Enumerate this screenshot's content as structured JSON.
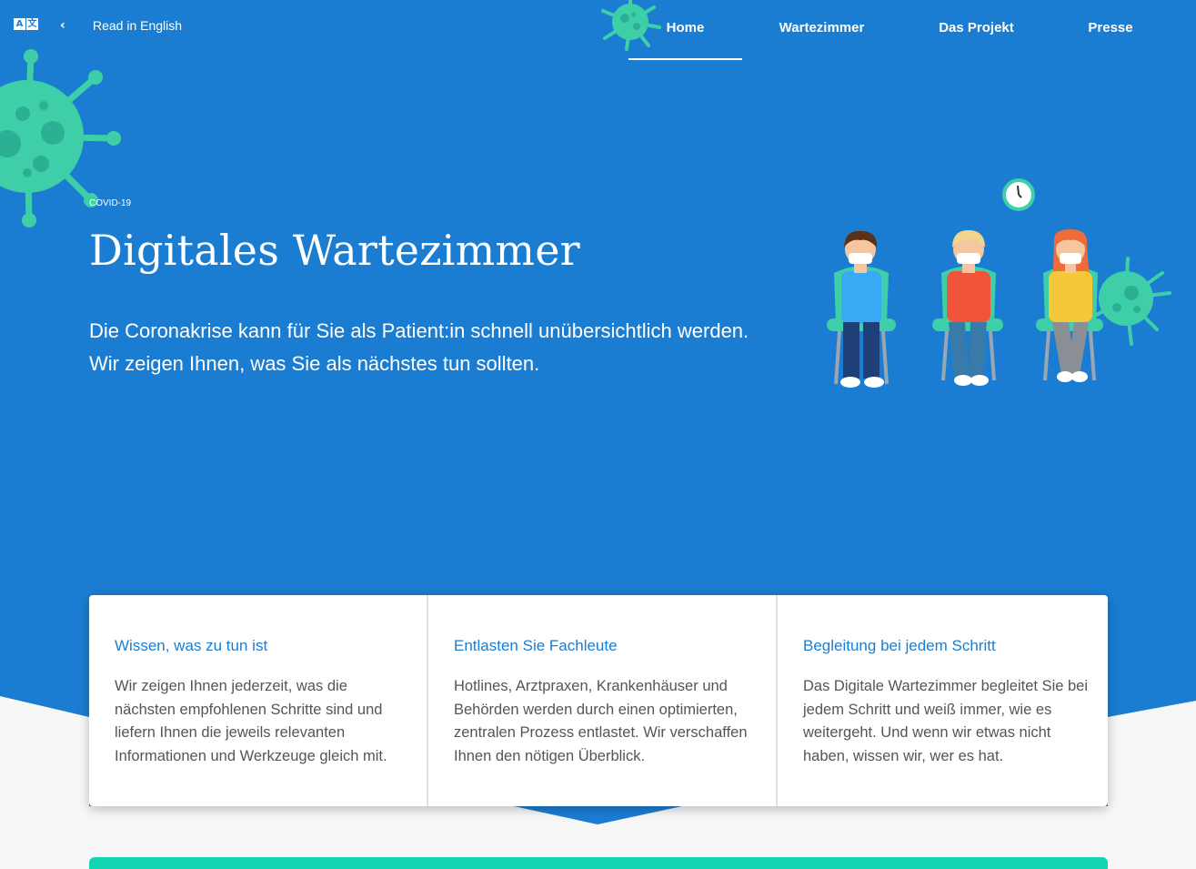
{
  "header": {
    "lang_icon": {
      "left": "A",
      "right": "文"
    },
    "back_icon": "chevron-left-icon",
    "read_in_english": "Read in English",
    "nav": [
      {
        "label": "Home",
        "active": true
      },
      {
        "label": "Wartezimmer",
        "active": false
      },
      {
        "label": "Das Projekt",
        "active": false
      },
      {
        "label": "Presse",
        "active": false
      }
    ]
  },
  "hero": {
    "eyebrow": "COVID-19",
    "title": "Digitales Wartezimmer",
    "lead": "Die Coronakrise kann für Sie als Patient:in schnell unübersichtlich werden. Wir zeigen Ihnen, was Sie als nächstes tun sollten."
  },
  "features": [
    {
      "title": "Wissen, was zu tun ist",
      "text": "Wir zeigen Ihnen jederzeit, was die nächsten empfohlenen Schritte sind und liefern Ihnen die jeweils relevanten Informationen und Werkzeuge gleich mit."
    },
    {
      "title": "Entlasten Sie Fachleute",
      "text": "Hotlines, Arztpraxen, Krankenhäuser und Behörden werden durch einen optimierten, zentralen Prozess entlastet. Wir verschaffen Ihnen den nötigen Überblick."
    },
    {
      "title": "Begleitung bei jedem Schritt",
      "text": "Das Digitale Wartezimmer begleitet Sie bei jedem Schritt und weiß immer, wie es weitergeht. Und wenn wir etwas nicht haben, wissen wir, wer es hat."
    }
  ],
  "colors": {
    "primary_blue": "#1b7dd1",
    "virus_teal": "#3fcfa8",
    "teal_strip": "#13d4b3",
    "page_bg": "#f7f7f7"
  }
}
